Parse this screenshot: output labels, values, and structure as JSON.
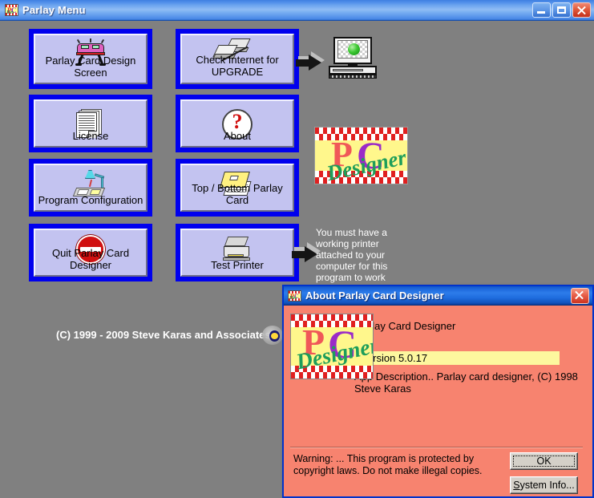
{
  "window": {
    "title": "Parlay Menu",
    "icon": "pc-designer-logo-icon",
    "controls": {
      "minimize": "_",
      "maximize": "□",
      "close": "✕"
    }
  },
  "menu_buttons": [
    {
      "id": "parlay-card-design-screen",
      "label": "Parlay Card Design Screen",
      "icon": "car-icon",
      "column": "left"
    },
    {
      "id": "license",
      "label": "License",
      "icon": "document-icon",
      "column": "left"
    },
    {
      "id": "program-configuration",
      "label": "Program Configuration",
      "icon": "desk-lamp-icon",
      "column": "left"
    },
    {
      "id": "quit-parlay-card-designer",
      "label": "Quit Parlay Card Designer",
      "icon": "no-entry-icon",
      "column": "left"
    },
    {
      "id": "check-internet-for-upgrade",
      "label": "Check Internet for\nUPGRADE",
      "icon": "network-computers-icon",
      "column": "right"
    },
    {
      "id": "about",
      "label": "About",
      "icon": "question-mark-icon",
      "column": "right"
    },
    {
      "id": "top-bottom-parlay-card",
      "label": "Top / Bottom Parlay Card",
      "icon": "card-pages-icon",
      "column": "right"
    },
    {
      "id": "test-printer",
      "label": "Test Printer",
      "icon": "printer-icon",
      "column": "right"
    }
  ],
  "decor": {
    "computer_icon": "computer-monitor-icon",
    "logo": {
      "p": "P",
      "c": "C",
      "designer": "Designer"
    },
    "printer_note": "You must have a\nworking printer\nattached to your\ncomputer for this\nprogram to work",
    "copyright": "(C) 1999 - 2009 Steve Karas and Associates"
  },
  "about_dialog": {
    "title": "About Parlay Card Designer",
    "close": "✕",
    "app_name": "Parlay Card Designer",
    "version": "Version 5.0.17",
    "description": "App Description..  Parlay card designer, (C) 1998\nSteve Karas",
    "warning": "Warning: ... This program is protected by copyright laws. Do not make illegal copies.",
    "buttons": {
      "ok": "OK",
      "system_info_prefix": "S",
      "system_info_rest": "ystem Info..."
    }
  },
  "colors": {
    "desktop": "#808080",
    "button_border": "#0000EE",
    "button_face": "#C3C3F0",
    "dialog_bg": "#F7836F",
    "version_highlight": "#FDF79E",
    "logo_yellow": "#FFF78C",
    "logo_p": "#F05858",
    "logo_c": "#9B2BC8",
    "logo_designer": "#1E9E5A"
  }
}
